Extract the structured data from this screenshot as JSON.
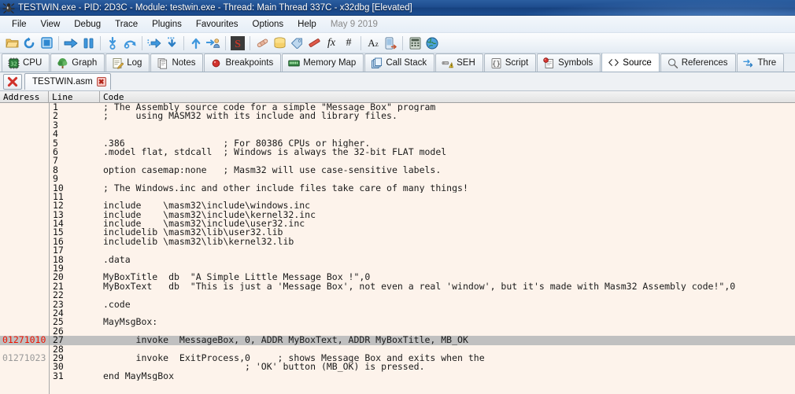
{
  "window": {
    "title": "TESTWIN.exe - PID: 2D3C - Module: testwin.exe - Thread: Main Thread 337C - x32dbg [Elevated]",
    "icon": "bug-icon"
  },
  "menubar": {
    "items": [
      {
        "label": "File"
      },
      {
        "label": "View"
      },
      {
        "label": "Debug"
      },
      {
        "label": "Trace"
      },
      {
        "label": "Plugins"
      },
      {
        "label": "Favourites"
      },
      {
        "label": "Options"
      },
      {
        "label": "Help"
      }
    ],
    "date": "May 9 2019"
  },
  "toolbar": {
    "buttons": [
      {
        "name": "open-file-icon",
        "title": "Open"
      },
      {
        "name": "restart-icon",
        "title": "Restart"
      },
      {
        "name": "stop-icon",
        "title": "Close"
      },
      {
        "sep": true
      },
      {
        "name": "run-icon",
        "title": "Run"
      },
      {
        "name": "pause-icon",
        "title": "Pause"
      },
      {
        "sep": true
      },
      {
        "name": "step-into-icon",
        "title": "Step into"
      },
      {
        "name": "step-over-icon",
        "title": "Step over"
      },
      {
        "sep": true
      },
      {
        "name": "run-to-selection-icon",
        "title": "Run to selection"
      },
      {
        "name": "step-out-icon",
        "title": "Step out"
      },
      {
        "sep": true
      },
      {
        "name": "execute-till-return-icon",
        "title": "Execute till return"
      },
      {
        "name": "run-to-user-code-icon",
        "title": "Run to user code"
      },
      {
        "sep": true
      },
      {
        "name": "scylla-icon",
        "title": "Scylla"
      },
      {
        "sep": true
      },
      {
        "name": "patches-icon",
        "title": "Patches"
      },
      {
        "name": "log-window-icon",
        "title": "Log"
      },
      {
        "name": "labels-icon",
        "title": "Labels"
      },
      {
        "name": "comments-icon",
        "title": "Comments"
      },
      {
        "name": "functions-icon",
        "title": "Functions"
      },
      {
        "name": "hash-icon",
        "title": "Hash"
      },
      {
        "sep": true
      },
      {
        "name": "font-icon",
        "title": "Font"
      },
      {
        "name": "handles-icon",
        "title": "Handles"
      },
      {
        "sep": true
      },
      {
        "name": "calculator-icon",
        "title": "Calculator"
      },
      {
        "name": "globe-icon",
        "title": "Browse"
      }
    ]
  },
  "tabs": [
    {
      "label": "CPU",
      "icon": "cpu-chip-icon",
      "active": false
    },
    {
      "label": "Graph",
      "icon": "tree-graph-icon",
      "active": false
    },
    {
      "label": "Log",
      "icon": "log-pencil-icon",
      "active": false
    },
    {
      "label": "Notes",
      "icon": "notes-page-icon",
      "active": false
    },
    {
      "label": "Breakpoints",
      "icon": "breakpoint-dot-icon",
      "active": false
    },
    {
      "label": "Memory Map",
      "icon": "memory-ram-icon",
      "active": false
    },
    {
      "label": "Call Stack",
      "icon": "call-stack-icon",
      "active": false
    },
    {
      "label": "SEH",
      "icon": "seh-warning-icon",
      "active": false
    },
    {
      "label": "Script",
      "icon": "script-brackets-icon",
      "active": false
    },
    {
      "label": "Symbols",
      "icon": "symbols-icon",
      "active": false
    },
    {
      "label": "Source",
      "icon": "source-angle-brackets-icon",
      "active": true
    },
    {
      "label": "References",
      "icon": "references-magnifier-icon",
      "active": false
    },
    {
      "label": "Thre",
      "icon": "threads-arrows-icon",
      "active": false
    }
  ],
  "file_tabs": {
    "close_all_icon": "red-x-icon",
    "items": [
      {
        "label": "TESTWIN.asm",
        "close_label": "✖",
        "active": true
      }
    ]
  },
  "columns": {
    "address": "Address",
    "line": "Line",
    "code": "Code"
  },
  "source": {
    "rows": [
      {
        "addr": "",
        "line": "1",
        "code": "; The Assembly source code for a simple \"Message Box\" program",
        "highlighted": false,
        "current": false
      },
      {
        "addr": "",
        "line": "2",
        "code": ";     using MASM32 with its include and library files.",
        "highlighted": false,
        "current": false
      },
      {
        "addr": "",
        "line": "3",
        "code": "",
        "highlighted": false,
        "current": false
      },
      {
        "addr": "",
        "line": "4",
        "code": "",
        "highlighted": false,
        "current": false
      },
      {
        "addr": "",
        "line": "5",
        "code": ".386                  ; For 80386 CPUs or higher.",
        "highlighted": false,
        "current": false
      },
      {
        "addr": "",
        "line": "6",
        "code": ".model flat, stdcall  ; Windows is always the 32-bit FLAT model",
        "highlighted": false,
        "current": false
      },
      {
        "addr": "",
        "line": "7",
        "code": "",
        "highlighted": false,
        "current": false
      },
      {
        "addr": "",
        "line": "8",
        "code": "option casemap:none   ; Masm32 will use case-sensitive labels.",
        "highlighted": false,
        "current": false
      },
      {
        "addr": "",
        "line": "9",
        "code": "",
        "highlighted": false,
        "current": false
      },
      {
        "addr": "",
        "line": "10",
        "code": "; The Windows.inc and other include files take care of many things!",
        "highlighted": false,
        "current": false
      },
      {
        "addr": "",
        "line": "11",
        "code": "",
        "highlighted": false,
        "current": false
      },
      {
        "addr": "",
        "line": "12",
        "code": "include    \\masm32\\include\\windows.inc",
        "highlighted": false,
        "current": false
      },
      {
        "addr": "",
        "line": "13",
        "code": "include    \\masm32\\include\\kernel32.inc",
        "highlighted": false,
        "current": false
      },
      {
        "addr": "",
        "line": "14",
        "code": "include    \\masm32\\include\\user32.inc",
        "highlighted": false,
        "current": false
      },
      {
        "addr": "",
        "line": "15",
        "code": "includelib \\masm32\\lib\\user32.lib",
        "highlighted": false,
        "current": false
      },
      {
        "addr": "",
        "line": "16",
        "code": "includelib \\masm32\\lib\\kernel32.lib",
        "highlighted": false,
        "current": false
      },
      {
        "addr": "",
        "line": "17",
        "code": "",
        "highlighted": false,
        "current": false
      },
      {
        "addr": "",
        "line": "18",
        "code": ".data",
        "highlighted": false,
        "current": false
      },
      {
        "addr": "",
        "line": "19",
        "code": "",
        "highlighted": false,
        "current": false
      },
      {
        "addr": "",
        "line": "20",
        "code": "MyBoxTitle  db  \"A Simple Little Message Box !\",0",
        "highlighted": false,
        "current": false
      },
      {
        "addr": "",
        "line": "21",
        "code": "MyBoxText   db  \"This is just a 'Message Box', not even a real 'window', but it's made with Masm32 Assembly code!\",0",
        "highlighted": false,
        "current": false
      },
      {
        "addr": "",
        "line": "22",
        "code": "",
        "highlighted": false,
        "current": false
      },
      {
        "addr": "",
        "line": "23",
        "code": ".code",
        "highlighted": false,
        "current": false
      },
      {
        "addr": "",
        "line": "24",
        "code": "",
        "highlighted": false,
        "current": false
      },
      {
        "addr": "",
        "line": "25",
        "code": "MayMsgBox:",
        "highlighted": false,
        "current": false
      },
      {
        "addr": "",
        "line": "26",
        "code": "",
        "highlighted": false,
        "current": false
      },
      {
        "addr": "01271010",
        "line": "27",
        "code": "      invoke  MessageBox, 0, ADDR MyBoxText, ADDR MyBoxTitle, MB_OK",
        "highlighted": true,
        "current": true
      },
      {
        "addr": "",
        "line": "28",
        "code": "",
        "highlighted": false,
        "current": false
      },
      {
        "addr": "01271023",
        "line": "29",
        "code": "      invoke  ExitProcess,0     ; shows Message Box and exits when the",
        "highlighted": false,
        "current": false
      },
      {
        "addr": "",
        "line": "30",
        "code": "                          ; 'OK' button (MB_OK) is pressed.",
        "highlighted": false,
        "current": false
      },
      {
        "addr": "",
        "line": "31",
        "code": "end MayMsgBox",
        "highlighted": false,
        "current": false
      }
    ]
  },
  "colors": {
    "title_bar": "#1e4d8f",
    "current_address": "#ee1100",
    "other_address": "#9a9a9a",
    "highlight_row": "#c0c0c0",
    "code_background": "#fdf3eb"
  }
}
